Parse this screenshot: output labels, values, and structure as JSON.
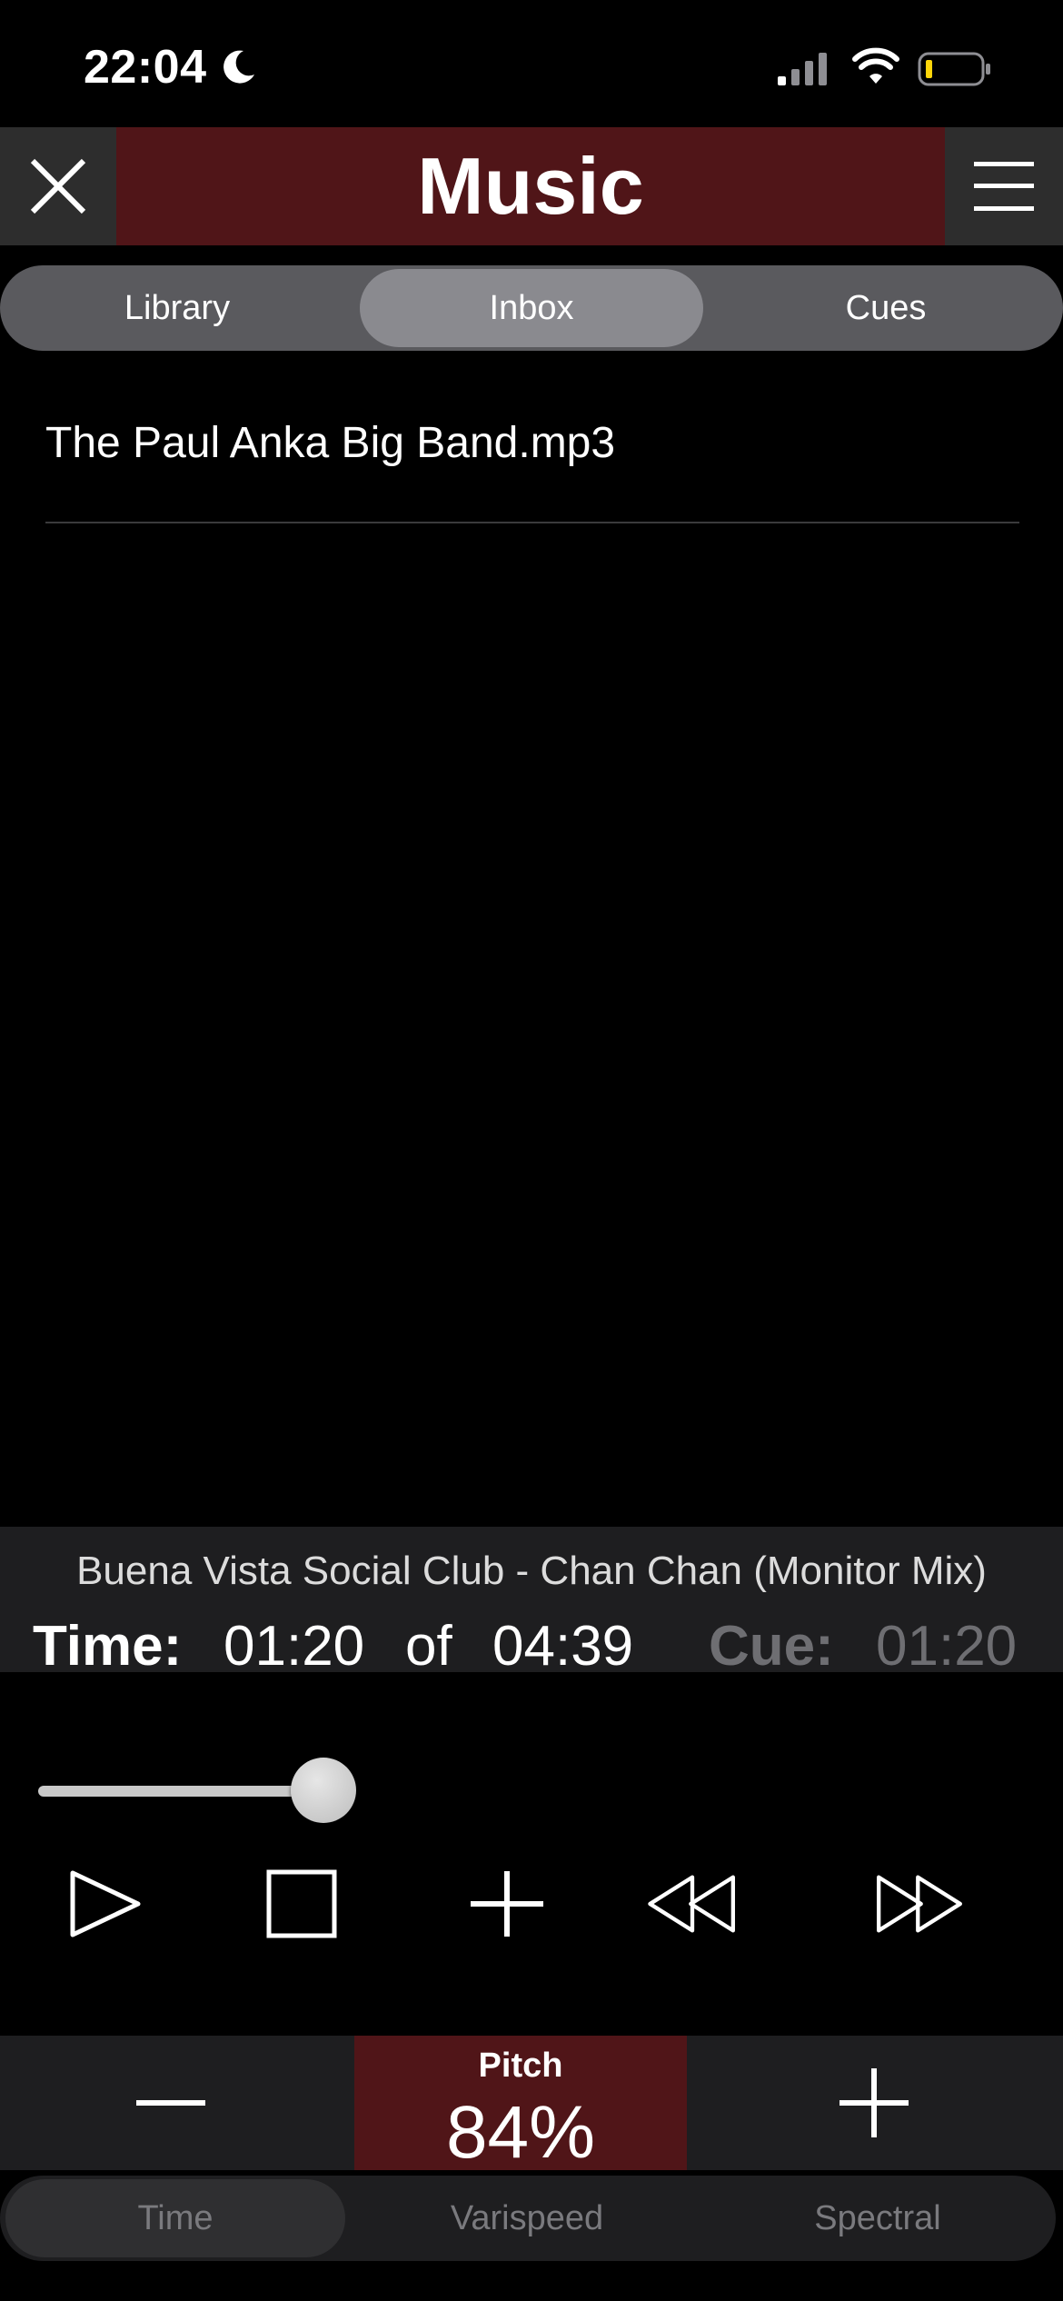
{
  "status": {
    "time": "22:04",
    "icons": [
      "moon-icon",
      "signal-icon",
      "wifi-icon",
      "battery-icon"
    ]
  },
  "header": {
    "title": "Music",
    "close_icon": "close-icon",
    "menu_icon": "hamburger-menu-icon",
    "accent": "#501518"
  },
  "tabs": [
    {
      "label": "Library",
      "active": false
    },
    {
      "label": "Inbox",
      "active": true
    },
    {
      "label": "Cues",
      "active": false
    }
  ],
  "list": {
    "items": [
      "The Paul Anka Big Band.mp3"
    ]
  },
  "player": {
    "song_title": "Buena Vista Social Club - Chan Chan (Monitor Mix)",
    "time_label": "Time:",
    "time_current": "01:20",
    "time_of": "of",
    "time_total": "04:39",
    "cue_label": "Cue:",
    "cue_value": "01:20",
    "progress_fraction": 0.287
  },
  "transport": {
    "icons": [
      "play-icon",
      "stop-icon",
      "add-cue-icon",
      "rewind-icon",
      "fast-forward-icon"
    ]
  },
  "pitch": {
    "label": "Pitch",
    "value": "84%"
  },
  "mode_tabs": [
    {
      "label": "Time",
      "active": true
    },
    {
      "label": "Varispeed",
      "active": false
    },
    {
      "label": "Spectral",
      "active": false
    }
  ]
}
